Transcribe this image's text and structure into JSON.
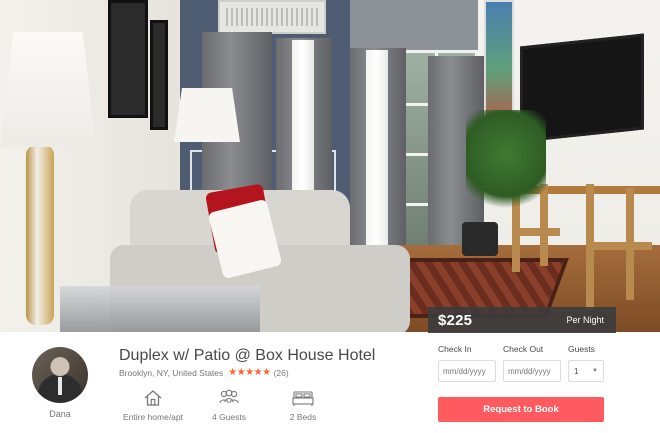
{
  "listing": {
    "price": "$225",
    "price_period": "Per Night",
    "title": "Duplex w/ Patio @ Box House Hotel",
    "location": "Brooklyn, NY, United States",
    "rating_stars": 5,
    "stars_glyphs": "★★★★★",
    "review_count": "(26)"
  },
  "host": {
    "name": "Dana"
  },
  "amenities": [
    {
      "label": "Entire home/apt",
      "icon": "home-icon"
    },
    {
      "label": "4 Guests",
      "icon": "guests-icon"
    },
    {
      "label": "2 Beds",
      "icon": "bed-icon"
    }
  ],
  "booking": {
    "check_in_label": "Check In",
    "check_out_label": "Check Out",
    "guests_label": "Guests",
    "check_in_placeholder": "mm/dd/yyyy",
    "check_out_placeholder": "mm/dd/yyyy",
    "guests_value": "1",
    "book_button": "Request to Book"
  },
  "colors": {
    "accent": "#ff5a5f",
    "star": "#fc642d",
    "price_banner": "#3c3c3c"
  }
}
